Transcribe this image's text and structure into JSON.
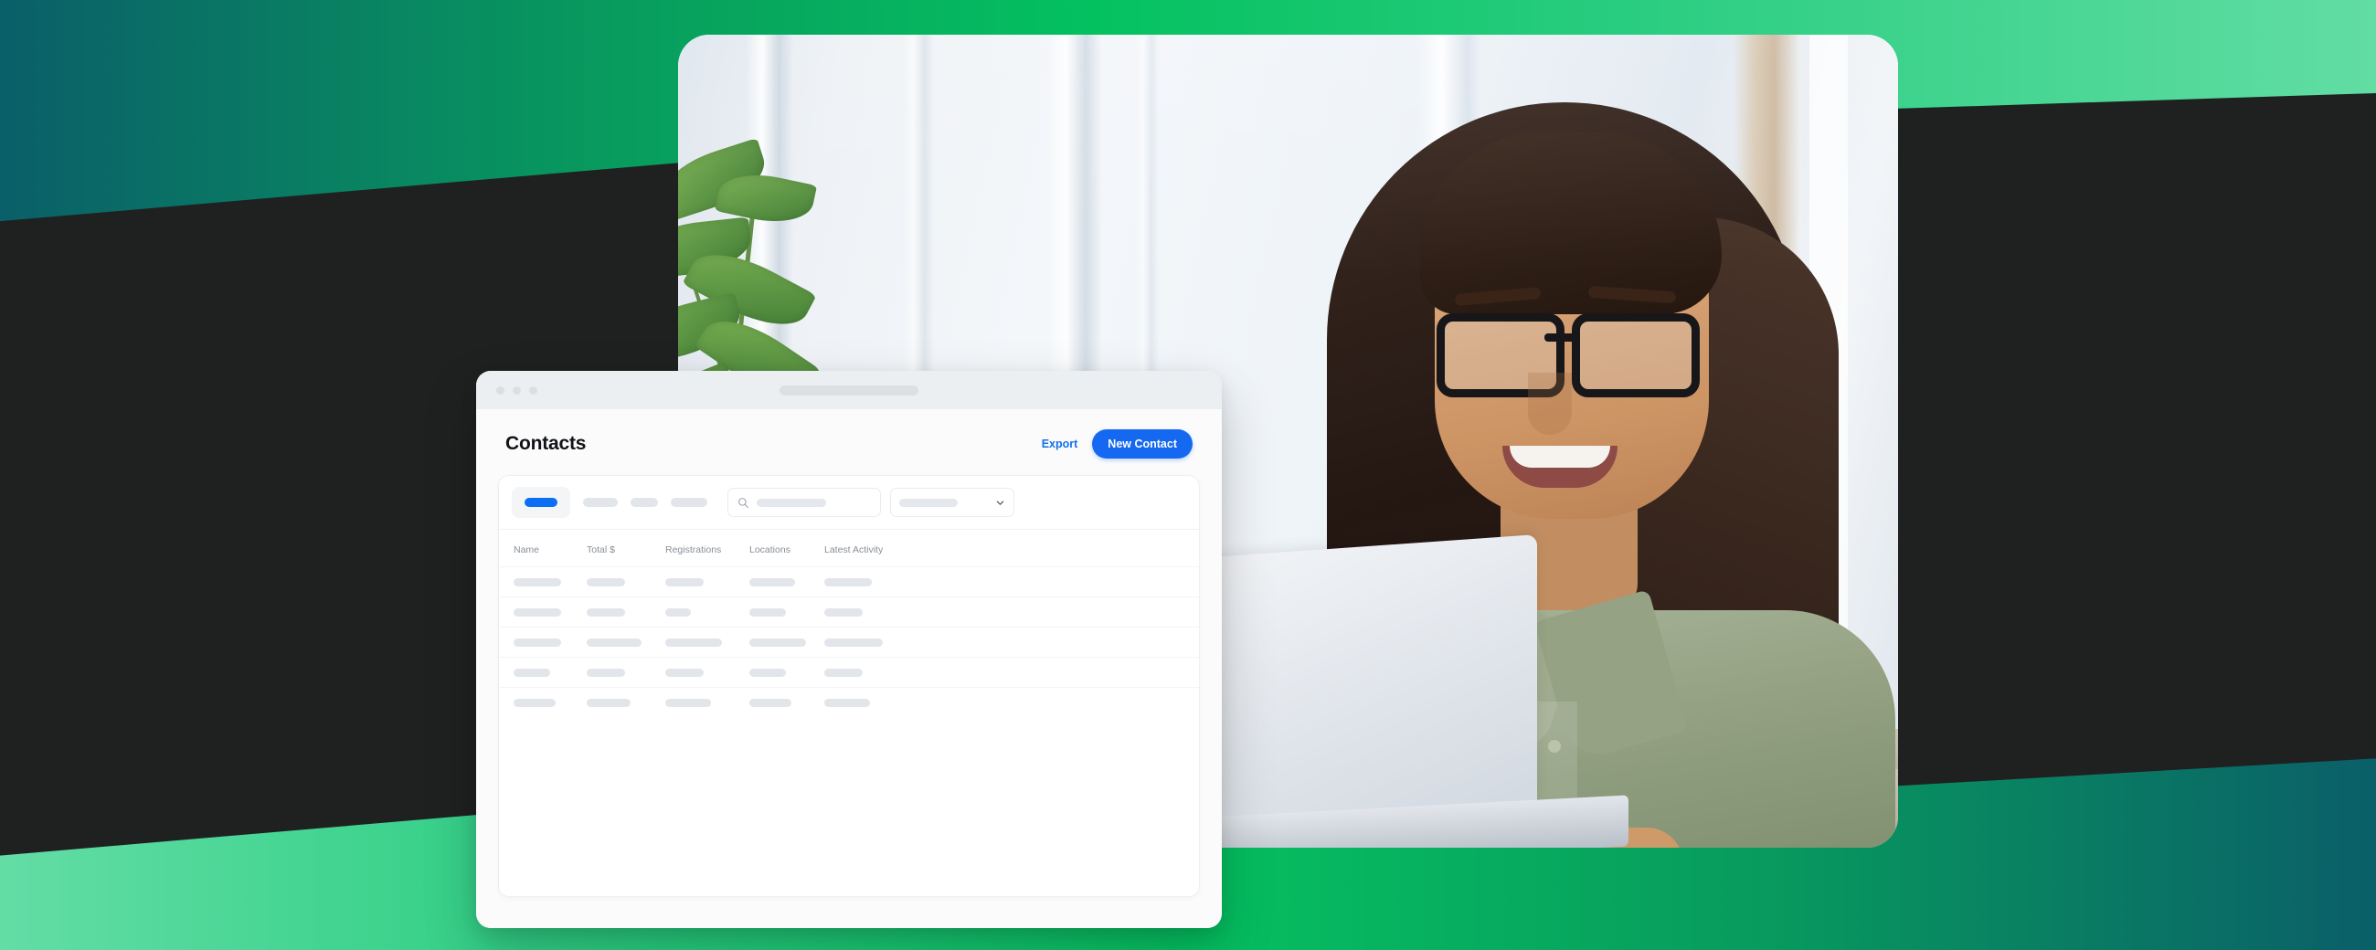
{
  "background": {
    "gradient_top": [
      "#0a5f68",
      "#04c160",
      "#62dda4"
    ],
    "gradient_bottom": [
      "#63dda5",
      "#05c060",
      "#0a5f68"
    ],
    "slab_color": "#1f2121"
  },
  "photo": {
    "alt": "Smiling woman with glasses working on a laptop by a bright window",
    "subject": "woman-at-laptop",
    "accent_plant": "green-houseplant"
  },
  "browser": {
    "traffic_lights": [
      "dot",
      "dot",
      "dot"
    ],
    "url_placeholder": ""
  },
  "header": {
    "title": "Contacts",
    "export_label": "Export",
    "new_contact_label": "New Contact",
    "accent_blue": "#1469f0",
    "link_blue": "#1471ec"
  },
  "toolbar": {
    "tabs": [
      {
        "name": "tab-all",
        "width": 36,
        "active": true
      },
      {
        "name": "tab-2",
        "width": 38,
        "active": false
      },
      {
        "name": "tab-3",
        "width": 30,
        "active": false
      },
      {
        "name": "tab-4",
        "width": 40,
        "active": false
      }
    ],
    "search": {
      "icon": "search-icon",
      "placeholder": "",
      "value_width": 76
    },
    "filter_select": {
      "icon": "chevron-down-icon",
      "value_width": 64
    }
  },
  "table": {
    "columns": [
      "Name",
      "Total $",
      "Registrations",
      "Locations",
      "Latest Activity"
    ],
    "rows": [
      {
        "widths": [
          52,
          42,
          42,
          50,
          52
        ]
      },
      {
        "widths": [
          52,
          42,
          28,
          40,
          42
        ]
      },
      {
        "widths": [
          52,
          60,
          62,
          62,
          64
        ]
      },
      {
        "widths": [
          40,
          42,
          42,
          40,
          42
        ]
      },
      {
        "widths": [
          46,
          48,
          50,
          46,
          50
        ]
      }
    ]
  }
}
